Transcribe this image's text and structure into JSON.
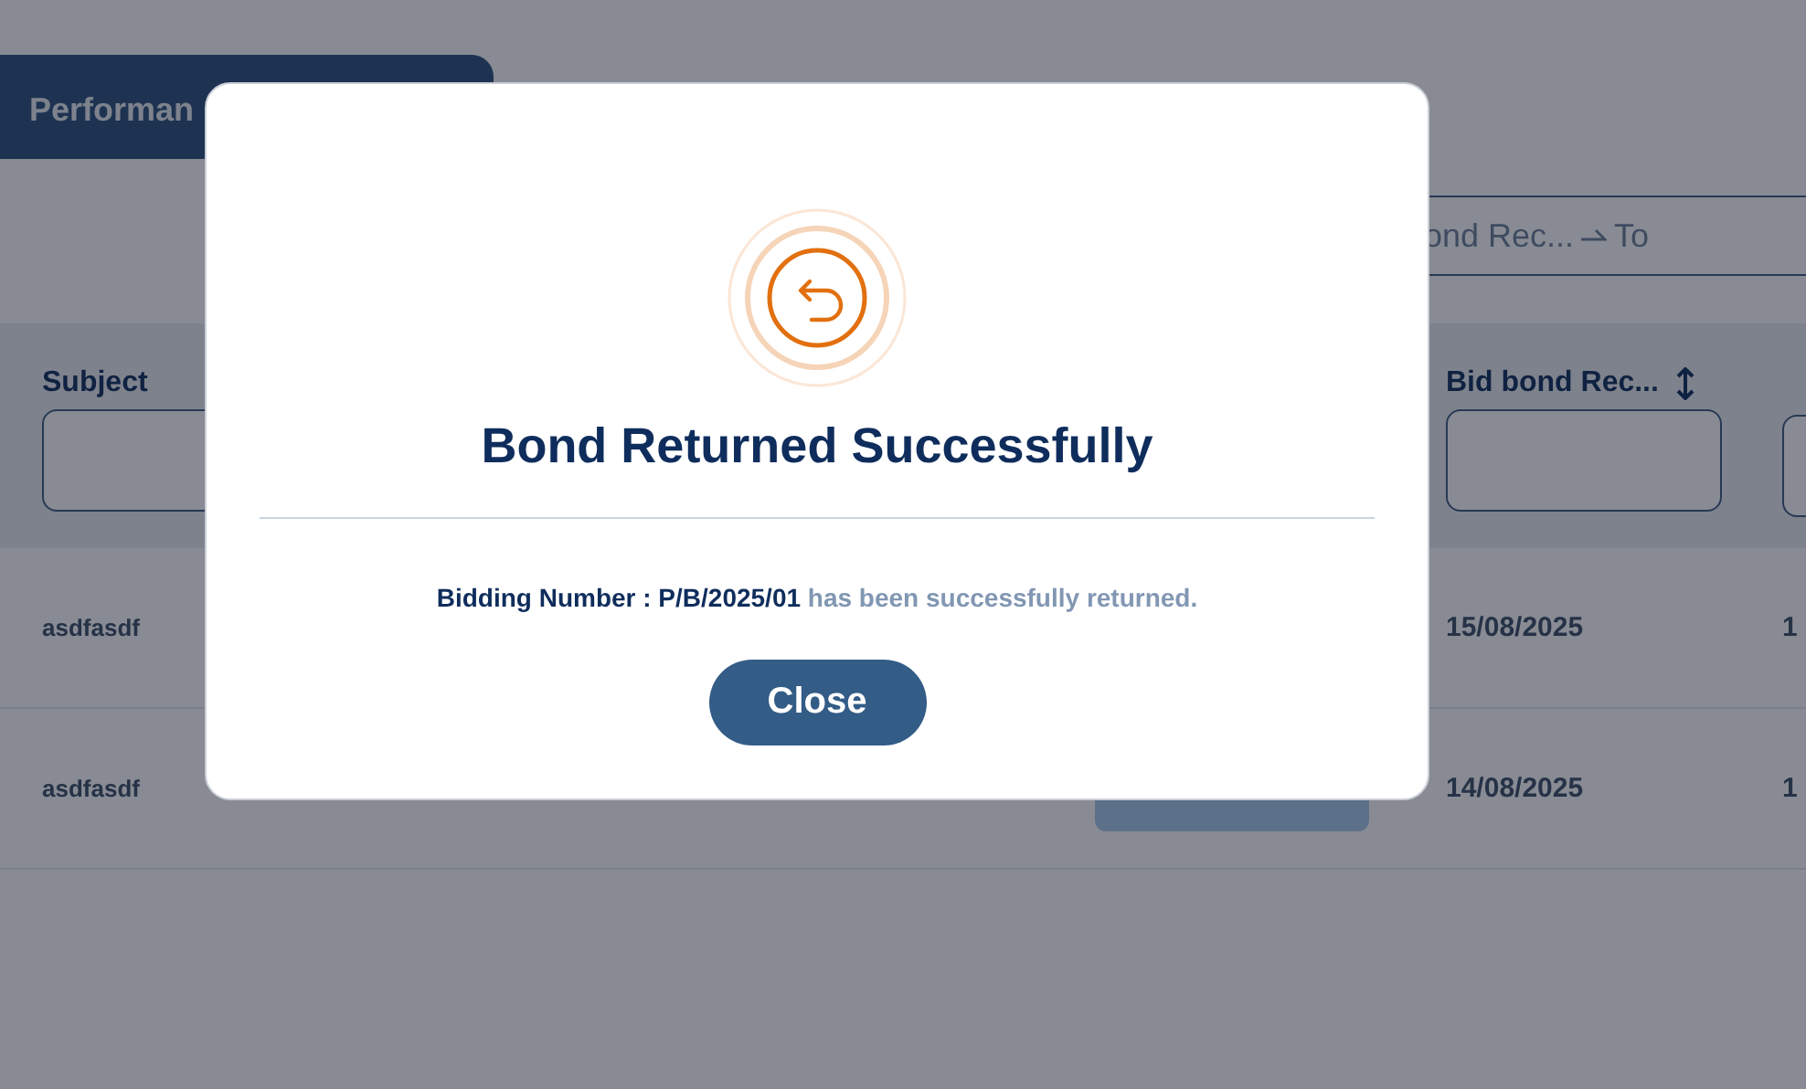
{
  "tab": {
    "label": "Performan"
  },
  "date_range": {
    "from_placeholder": "ond Rec...",
    "to_placeholder": "To"
  },
  "table": {
    "columns": [
      {
        "label": "Subject",
        "sortable": false
      },
      {
        "label": "Bid bond Rec...",
        "sortable": true
      }
    ],
    "rows": [
      {
        "subject": "asdfasdf",
        "has_action_button": false,
        "date": "15/08/2025",
        "column_3": "1"
      },
      {
        "subject": "asdfasdf",
        "has_action_button": true,
        "date": "14/08/2025",
        "column_3": "1"
      }
    ]
  },
  "modal": {
    "title": "Bond Returned Successfully",
    "message": "**Bidding Number : P/B/2025/01** has been successfully returned.",
    "button": "Close"
  }
}
